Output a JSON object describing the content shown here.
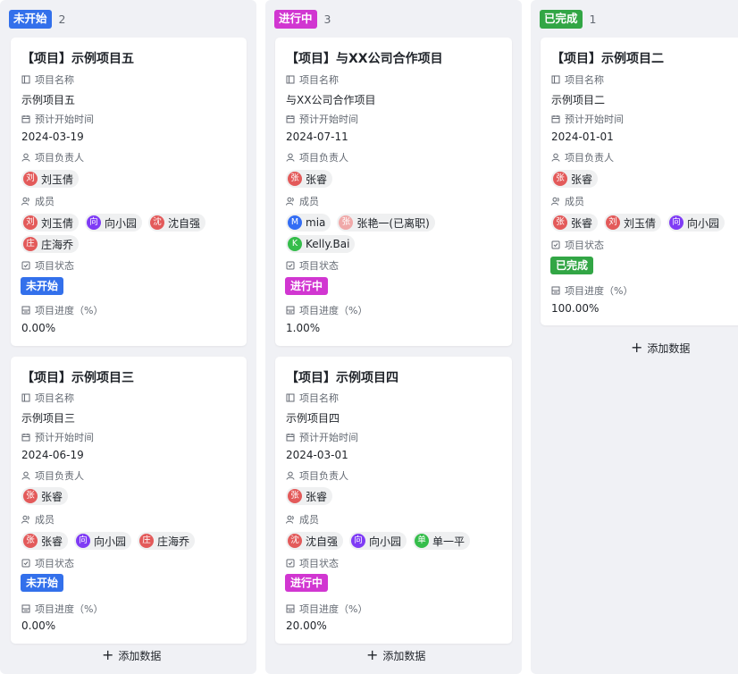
{
  "colors": {
    "not_started": "#3370eb",
    "in_progress": "#d136d1",
    "completed": "#32a645",
    "avatar_red": "#e35a5a",
    "avatar_purple": "#7f3bf5",
    "avatar_blue": "#336df4",
    "avatar_green": "#35bd4b",
    "avatar_pink": "#f0a9a9"
  },
  "labels": {
    "name": "项目名称",
    "start": "预计开始时间",
    "owner": "项目负责人",
    "members": "成员",
    "status": "项目状态",
    "progress": "项目进度（%）"
  },
  "add_data_label": "添加数据",
  "columns": [
    {
      "status": "未开始",
      "count": "2",
      "cards": [
        {
          "title": "【项目】示例项目五",
          "name": "示例项目五",
          "start": "2024-03-19",
          "owner": [
            {
              "initial": "刘",
              "name": "刘玉倩",
              "color": "red"
            }
          ],
          "members": [
            {
              "initial": "刘",
              "name": "刘玉倩",
              "color": "red"
            },
            {
              "initial": "向",
              "name": "向小园",
              "color": "purple"
            },
            {
              "initial": "沈",
              "name": "沈自强",
              "color": "red"
            },
            {
              "initial": "庄",
              "name": "庄海乔",
              "color": "red"
            }
          ],
          "status": "未开始",
          "progress": "0.00%"
        },
        {
          "title": "【项目】示例项目三",
          "name": "示例项目三",
          "start": "2024-06-19",
          "owner": [
            {
              "initial": "张",
              "name": "张睿",
              "color": "red"
            }
          ],
          "members": [
            {
              "initial": "张",
              "name": "张睿",
              "color": "red"
            },
            {
              "initial": "向",
              "name": "向小园",
              "color": "purple"
            },
            {
              "initial": "庄",
              "name": "庄海乔",
              "color": "red"
            }
          ],
          "status": "未开始",
          "progress": "0.00%"
        }
      ]
    },
    {
      "status": "进行中",
      "count": "3",
      "cards": [
        {
          "title": "【项目】与XX公司合作项目",
          "name": "与XX公司合作项目",
          "start": "2024-07-11",
          "owner": [
            {
              "initial": "张",
              "name": "张睿",
              "color": "red"
            }
          ],
          "members": [
            {
              "initial": "M",
              "name": "mia",
              "color": "blue"
            },
            {
              "initial": "张",
              "name": "张艳一(已离职)",
              "color": "pink"
            },
            {
              "initial": "K",
              "name": "Kelly.Bai",
              "color": "green"
            }
          ],
          "status": "进行中",
          "progress": "1.00%"
        },
        {
          "title": "【项目】示例项目四",
          "name": "示例项目四",
          "start": "2024-03-01",
          "owner": [
            {
              "initial": "张",
              "name": "张睿",
              "color": "red"
            }
          ],
          "members": [
            {
              "initial": "沈",
              "name": "沈自强",
              "color": "red"
            },
            {
              "initial": "向",
              "name": "向小园",
              "color": "purple"
            },
            {
              "initial": "单",
              "name": "单一平",
              "color": "green"
            }
          ],
          "status": "进行中",
          "progress": "20.00%"
        }
      ]
    },
    {
      "status": "已完成",
      "count": "1",
      "cards": [
        {
          "title": "【项目】示例项目二",
          "name": "示例项目二",
          "start": "2024-01-01",
          "owner": [
            {
              "initial": "张",
              "name": "张睿",
              "color": "red"
            }
          ],
          "members": [
            {
              "initial": "张",
              "name": "张睿",
              "color": "red"
            },
            {
              "initial": "刘",
              "name": "刘玉倩",
              "color": "red"
            },
            {
              "initial": "向",
              "name": "向小园",
              "color": "purple"
            }
          ],
          "status": "已完成",
          "progress": "100.00%"
        }
      ]
    }
  ]
}
